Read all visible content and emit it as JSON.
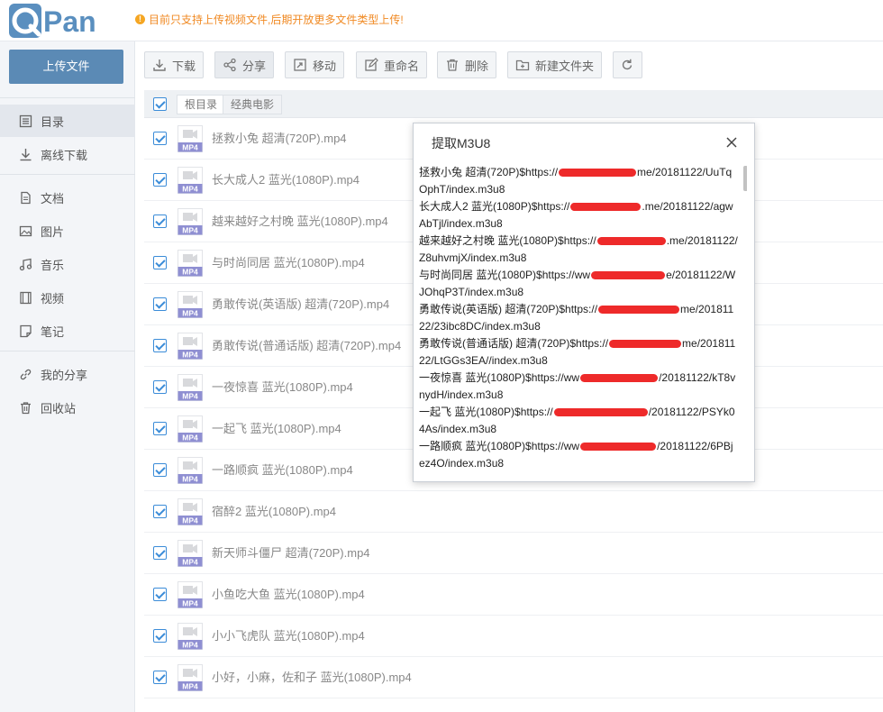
{
  "app": {
    "logo_text": "QPan",
    "notice": "目前只支持上传视频文件,后期开放更多文件类型上传!",
    "upload_label": "上传文件"
  },
  "sidebar": {
    "items": [
      {
        "label": "目录",
        "icon": "list-icon"
      },
      {
        "label": "离线下载",
        "icon": "download-icon"
      },
      {
        "label": "文档",
        "icon": "document-icon"
      },
      {
        "label": "图片",
        "icon": "image-icon"
      },
      {
        "label": "音乐",
        "icon": "music-icon"
      },
      {
        "label": "视频",
        "icon": "video-icon"
      },
      {
        "label": "笔记",
        "icon": "note-icon"
      },
      {
        "label": "我的分享",
        "icon": "link-icon"
      },
      {
        "label": "回收站",
        "icon": "trash-icon"
      }
    ]
  },
  "toolbar": {
    "download": "下载",
    "share": "分享",
    "move": "移动",
    "rename": "重命名",
    "delete": "删除",
    "new_folder": "新建文件夹"
  },
  "breadcrumb": {
    "root": "根目录",
    "current": "经典电影"
  },
  "files": [
    "拯救小兔 超清(720P).mp4",
    "长大成人2 蓝光(1080P).mp4",
    "越来越好之村晚 蓝光(1080P).mp4",
    "与时尚同居 蓝光(1080P).mp4",
    "勇敢传说(英语版) 超清(720P).mp4",
    "勇敢传说(普通话版) 超清(720P).mp4",
    "一夜惊喜 蓝光(1080P).mp4",
    "一起飞 蓝光(1080P).mp4",
    "一路顺疯 蓝光(1080P).mp4",
    "宿醉2 蓝光(1080P).mp4",
    "新天师斗僵尸 超清(720P).mp4",
    "小鱼吃大鱼 蓝光(1080P).mp4",
    "小小飞虎队 蓝光(1080P).mp4",
    "小好，小麻，佐和子 蓝光(1080P).mp4"
  ],
  "file_badge": "MP4",
  "modal": {
    "title": "提取M3U8",
    "entries": [
      {
        "pre": "拯救小兔 超清(720P)$https://",
        "post": "me/20181122/UuTqOphT/index.m3u8",
        "redact": 86
      },
      {
        "pre": "长大成人2 蓝光(1080P)$https://",
        "post": ".me/20181122/agwAbTjl/index.m3u8",
        "redact": 78
      },
      {
        "pre": "越来越好之村晚 蓝光(1080P)$https://",
        "post": ".me/20181122/Z8uhvmjX/index.m3u8",
        "redact": 76
      },
      {
        "pre": "与时尚同居 蓝光(1080P)$https://ww",
        "post": "e/20181122/WJOhqP3T/index.m3u8",
        "redact": 82
      },
      {
        "pre": "勇敢传说(英语版) 超清(720P)$https://",
        "post": "me/20181122/23ibc8DC/index.m3u8",
        "redact": 90
      },
      {
        "pre": "勇敢传说(普通话版) 超清(720P)$https://",
        "post": "me/20181122/LtGGs3EA//index.m3u8",
        "redact": 80
      },
      {
        "pre": "一夜惊喜 蓝光(1080P)$https://ww",
        "post": "/20181122/kT8vnydH/index.m3u8",
        "redact": 86
      },
      {
        "pre": "一起飞 蓝光(1080P)$https://",
        "post": "/20181122/PSYk04As/index.m3u8",
        "redact": 104
      },
      {
        "pre": "一路顺疯 蓝光(1080P)$https://ww",
        "post": "/20181122/6PBjez4O/index.m3u8",
        "redact": 84
      }
    ]
  },
  "colors": {
    "accent": "#3b8cd8",
    "upload_button": "#5b8ab5",
    "notice": "#f08a24",
    "redaction": "#ee2a2a",
    "file_badge": "#8f8fd2"
  }
}
